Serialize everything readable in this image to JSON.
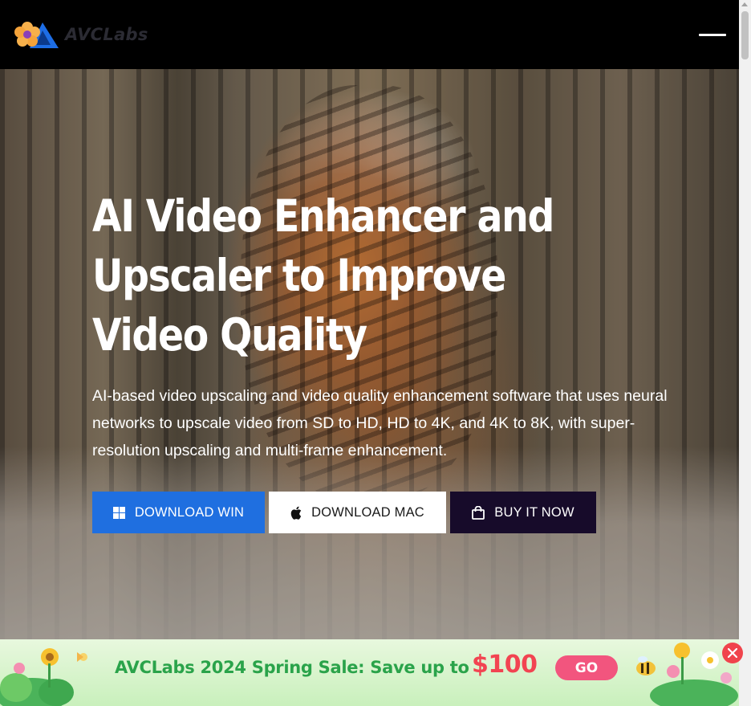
{
  "header": {
    "logo_text": "AVCLabs",
    "icons": {
      "logo": "flower-triangle-logo-icon",
      "menu": "hamburger-menu-icon"
    }
  },
  "hero": {
    "title": "AI Video Enhancer and Upscaler to Improve Video Quality",
    "description": "AI-based video upscaling and video quality enhancement software that uses neural networks to upscale video from SD to HD, HD to 4K, and 4K to 8K, with super-resolution upscaling and multi-frame enhancement.",
    "buttons": {
      "download_win": "DOWNLOAD WIN",
      "download_mac": "DOWNLOAD MAC",
      "buy_now": "BUY IT NOW"
    },
    "icons": {
      "win": "windows-icon",
      "mac": "apple-icon",
      "buy": "shopping-bag-icon"
    }
  },
  "banner": {
    "text": "AVCLabs 2024 Spring Sale: Save up to",
    "price": "$100",
    "go_label": "GO",
    "icons": {
      "close": "close-icon"
    }
  },
  "colors": {
    "win_button": "#1f6fe0",
    "buy_button": "#170b2a",
    "banner_text": "#2aa34a",
    "banner_price": "#f24451",
    "go_button": "#f2557e"
  }
}
